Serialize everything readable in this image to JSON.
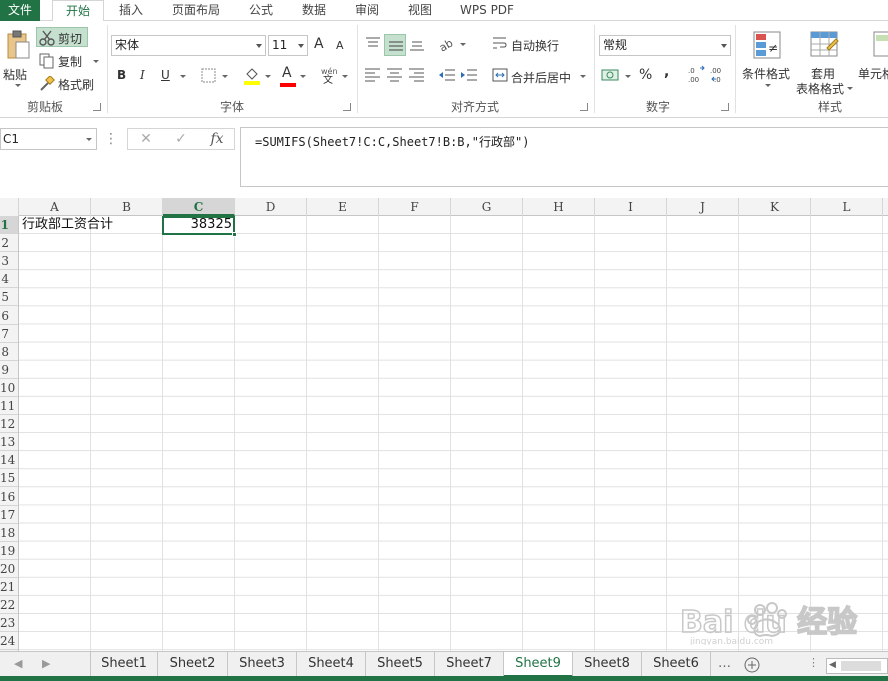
{
  "tabs": [
    "文件",
    "开始",
    "插入",
    "页面布局",
    "公式",
    "数据",
    "审阅",
    "视图",
    "WPS PDF"
  ],
  "clipboard": {
    "paste": "粘贴",
    "cut": "剪切",
    "copy": "复制",
    "format_painter": "格式刷",
    "label": "剪贴板"
  },
  "font": {
    "name": "宋体",
    "size": "11",
    "bold": "B",
    "italic": "I",
    "underline": "U",
    "grow": "A",
    "shrink": "A",
    "color_letter": "A",
    "label": "字体",
    "highlight_color": "#ffff00",
    "font_color": "#ff0000"
  },
  "align": {
    "wrap": "自动换行",
    "merge": "合并后居中",
    "label": "对齐方式"
  },
  "number": {
    "format": "常规",
    "percent": "%",
    "comma": ",",
    "inc_dec": ".00 →.0",
    "label": "数字"
  },
  "styles": {
    "conditional": "条件格式",
    "table_format_1": "套用",
    "table_format_2": "表格格式",
    "cell_styles": "单元格",
    "label": "样式"
  },
  "formula_bar": {
    "name_box": "C1",
    "fx": "fx",
    "formula": "=SUMIFS(Sheet7!C:C,Sheet7!B:B,\"行政部\")"
  },
  "columns": [
    "A",
    "B",
    "C",
    "D",
    "E",
    "F",
    "G",
    "H",
    "I",
    "J",
    "K",
    "L"
  ],
  "rows": [
    "1",
    "2",
    "3",
    "4",
    "5",
    "6",
    "7",
    "8",
    "9",
    "10",
    "11",
    "12",
    "13",
    "14",
    "15",
    "16",
    "17",
    "18",
    "19",
    "20",
    "21",
    "22",
    "23",
    "24"
  ],
  "cells": {
    "A1": "行政部工资合计",
    "C1": "38325"
  },
  "sheets": [
    "Sheet1",
    "Sheet2",
    "Sheet3",
    "Sheet4",
    "Sheet5",
    "Sheet7",
    "Sheet9",
    "Sheet8",
    "Sheet6"
  ],
  "active_sheet": "Sheet9",
  "accent_color": "#217346",
  "watermark": "Bai du 经验",
  "watermark_url": "jingyan.baidu.com"
}
